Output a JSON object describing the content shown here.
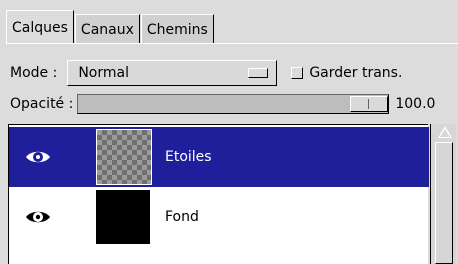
{
  "tabs": [
    {
      "label": "Calques",
      "active": true
    },
    {
      "label": "Canaux",
      "active": false
    },
    {
      "label": "Chemins",
      "active": false
    }
  ],
  "mode": {
    "label": "Mode :",
    "value": "Normal"
  },
  "keep_transparency": {
    "label": "Garder trans.",
    "checked": false
  },
  "opacity": {
    "label": "Opacité :",
    "value": "100.0",
    "level": 1.0
  },
  "layers": [
    {
      "name": "Etoiles",
      "visible": true,
      "selected": true,
      "thumbnail": "checkerboard"
    },
    {
      "name": "Fond",
      "visible": true,
      "selected": false,
      "thumbnail": "black"
    }
  ],
  "icons": {
    "eye": "eye-icon",
    "scroll_up": "scroll-up-arrow-icon"
  },
  "colors": {
    "selection": "#1f1f9b",
    "background": "#dcdcdc",
    "list_bg": "#ffffff"
  }
}
